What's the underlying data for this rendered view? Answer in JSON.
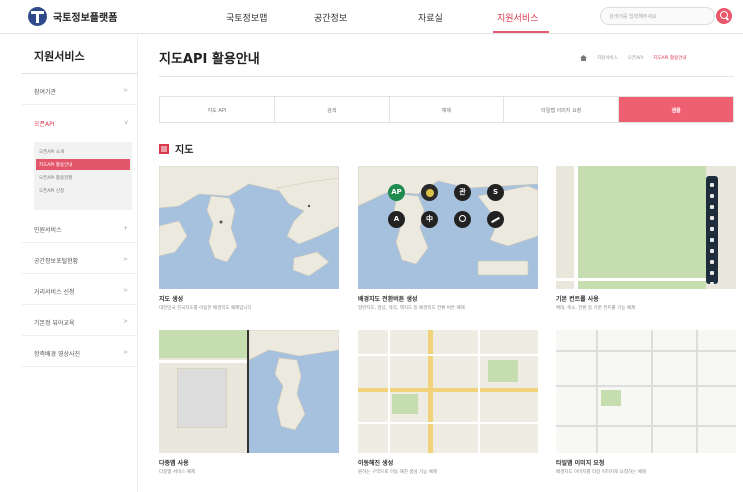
{
  "header": {
    "logo_text": "국토정보플랫폼",
    "nav": [
      "국토정보맵",
      "공간정보",
      "자료실",
      "지원서비스"
    ],
    "active_nav": "지원서비스",
    "search_placeholder": "검색어를 입력해주세요",
    "accent_color": "#e9576a"
  },
  "sidebar": {
    "title": "지원서비스",
    "items": [
      "참여기관",
      "오픈API",
      "민원서비스",
      "공간정보포털현황",
      "거리서비스 신청",
      "기본정 뷰어교육",
      "항측배경 영상사진"
    ],
    "sub_items": [
      "오픈API 소개",
      "지도API 활용안내",
      "오픈API 활용현황",
      "오픈API 신청"
    ],
    "active_sub": "지도API 활용안내"
  },
  "main": {
    "page_title": "지도API 활용안내",
    "breadcrumb": [
      "지원서비스",
      "오픈API",
      "지도API 활용안내"
    ],
    "tabs": [
      "지도 API",
      "검색",
      "예제",
      "타일맵 이미지 요청",
      "샘플"
    ],
    "active_tab": "샘플",
    "section_title": "지도",
    "cards": [
      {
        "title": "지도 생성",
        "desc": "대한민국 전국지도를 이용한 배경지도 예제입니다"
      },
      {
        "title": "배경지도 전환버튼 생성",
        "desc": "일반지도, 영상, 색각, 백지도 등 배경지도 전환 버튼 예제"
      },
      {
        "title": "기본 컨트롤 사용",
        "desc": "확대, 축소, 전환 등 기본 컨트롤 기능 예제"
      },
      {
        "title": "다중맵 사용",
        "desc": "다중맵 서비스 예제"
      },
      {
        "title": "이동해진 생성",
        "desc": "원하는 구역으로 이동 해진 생성 기능 예제"
      },
      {
        "title": "타일맵 이미지 요청",
        "desc": "배경지도 이미지를 타일 이미지로 요청하는 예제"
      }
    ],
    "map_buttons": [
      "AP",
      "",
      "관",
      "S",
      "A",
      "中",
      "",
      ""
    ]
  }
}
